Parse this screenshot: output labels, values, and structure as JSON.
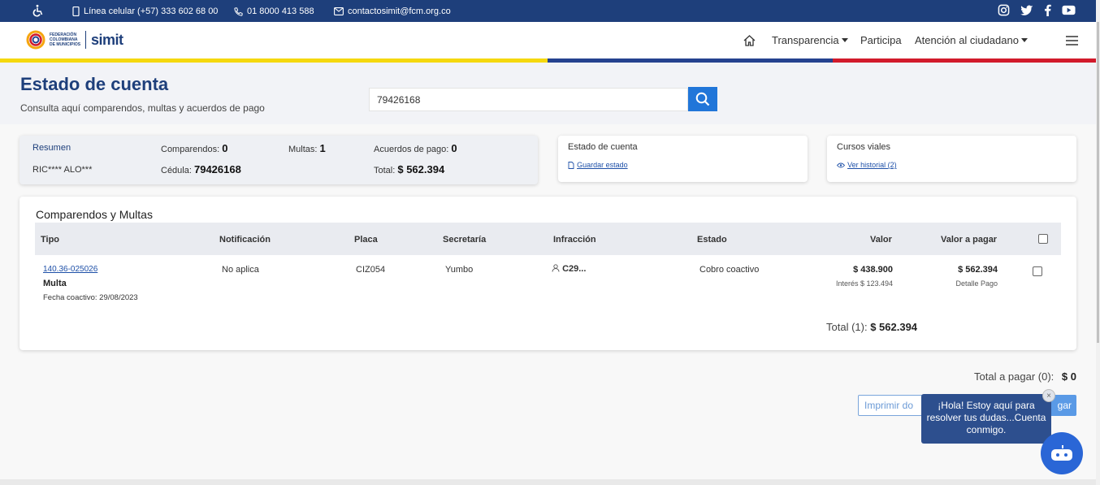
{
  "topbar": {
    "accessibility_icon": "wheelchair-icon",
    "mobile_line": "Línea celular (+57) 333 602 68 00",
    "phone_line": "01 8000 413 588",
    "email": "contactosimit@fcm.org.co",
    "socials": [
      "instagram-icon",
      "twitter-icon",
      "facebook-icon",
      "youtube-icon"
    ]
  },
  "header": {
    "logo_text": "FEDERACIÓN COLOMBIANA DE MUNICIPIOS",
    "logo_brand": "simit",
    "nav": {
      "home_icon": "home-icon",
      "transparencia": "Transparencia",
      "participa": "Participa",
      "atencion": "Atención al ciudadano",
      "menu_icon": "hamburger-menu-icon"
    },
    "stripe_colors": [
      "#f5d80f",
      "#25428f",
      "#d21a2b"
    ]
  },
  "page": {
    "title": "Estado de cuenta",
    "subtitle": "Consulta aquí comparendos, multas y acuerdos de pago"
  },
  "search": {
    "value": "79426168",
    "button_icon": "search-icon"
  },
  "summary": {
    "resumen_label": "Resumen",
    "name": "RIC**** ALO***",
    "comparendos_label": "Comparendos:",
    "comparendos_value": "0",
    "cedula_label": "Cédula:",
    "cedula_value": "79426168",
    "multas_label": "Multas:",
    "multas_value": "1",
    "acuerdos_label": "Acuerdos de pago:",
    "acuerdos_value": "0",
    "total_label": "Total:",
    "total_value": "$ 562.394"
  },
  "estado_card": {
    "title": "Estado de cuenta",
    "link": "Guardar estado"
  },
  "cursos_card": {
    "title": "Cursos viales",
    "link": "Ver historial (2)"
  },
  "table": {
    "title": "Comparendos y Multas",
    "headers": [
      "Tipo",
      "Notificación",
      "Placa",
      "Secretaría",
      "Infracción",
      "Estado",
      "Valor",
      "Valor a pagar"
    ],
    "row": {
      "id_link": "140.36-025026",
      "tipo": "Multa",
      "fecha": "Fecha coactivo: 29/08/2023",
      "notificacion": "No aplica",
      "placa": "CIZ054",
      "secretaria": "Yumbo",
      "infraccion": "C29...",
      "estado": "Cobro coactivo",
      "valor": "$ 438.900",
      "interes": "Interés $ 123.494",
      "valor_pagar": "$ 562.394",
      "detalle": "Detalle Pago"
    },
    "total_label": "Total (1):",
    "total_value": "$ 562.394"
  },
  "footer": {
    "total_pagar_label": "Total a pagar (0):",
    "total_pagar_value": "$ 0",
    "imprimir": "Imprimir do",
    "pagar": "gar"
  },
  "chat": {
    "message": "¡Hola! Estoy aquí para resolver tus dudas...Cuenta conmigo.",
    "close": "×",
    "bot_icon": "chatbot-icon"
  }
}
